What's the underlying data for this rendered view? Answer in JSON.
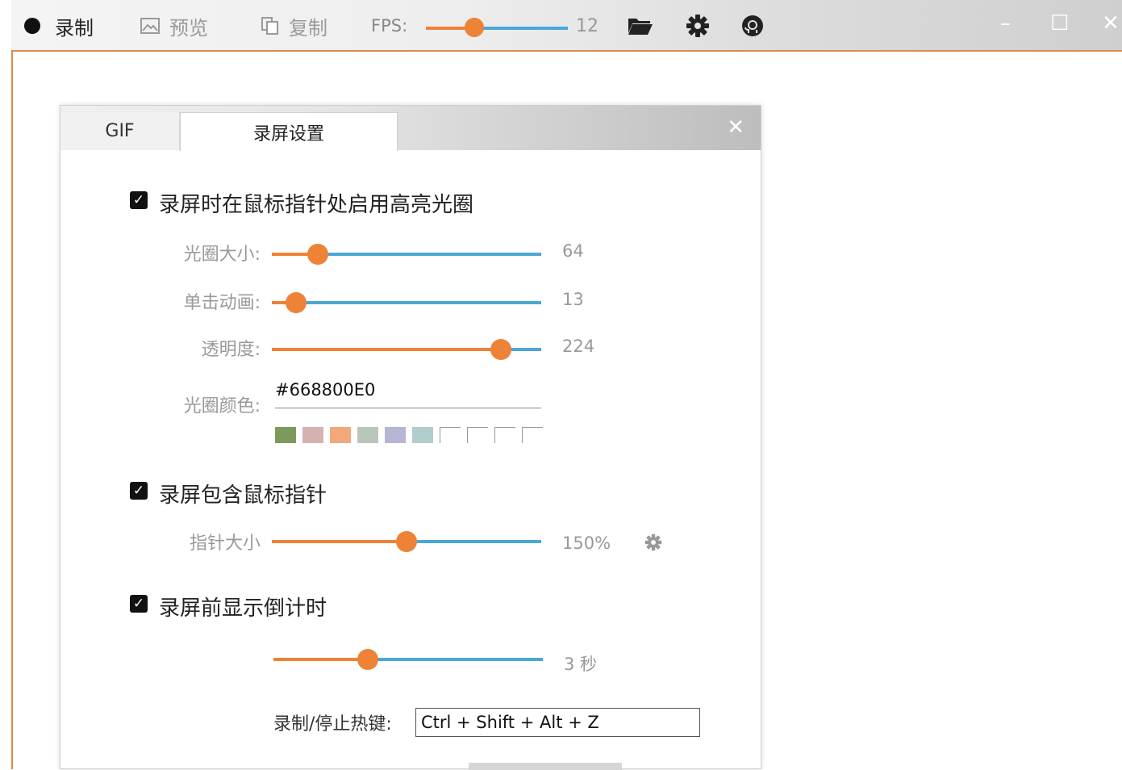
{
  "toolbar": {
    "record_label": "录制",
    "preview_label": "预览",
    "copy_label": "复制",
    "fps_label": "FPS:",
    "fps_value": "12",
    "fps_level": 0.34,
    "minimize": "–",
    "maximize": "☐",
    "close": "✕"
  },
  "dialog": {
    "tab_gif": "GIF",
    "tab_record": "录屏设置",
    "close": "✕",
    "highlight": {
      "title": "录屏时在鼠标指针处启用高亮光圈",
      "size_label": "光圈大小:",
      "size_value": "64",
      "size_level": 0.17,
      "click_label": "单击动画:",
      "click_value": "13",
      "click_level": 0.09,
      "opacity_label": "透明度:",
      "opacity_value": "224",
      "opacity_level": 0.85,
      "color_label": "光圈颜色:",
      "color_value": "#668800E0",
      "swatches": [
        "#7d9a5c",
        "#d6b1b1",
        "#f3a87b",
        "#b9c6ba",
        "#b5b5d4",
        "#b1cdcc"
      ]
    },
    "cursor": {
      "title": "录屏包含鼠标指针",
      "size_label": "指针大小",
      "size_value": "150%",
      "size_level": 0.5
    },
    "countdown": {
      "title": "录屏前显示倒计时",
      "value": "3 秒",
      "level": 0.35
    },
    "hotkey": {
      "label": "录制/停止热键:",
      "value": "Ctrl + Shift + Alt + Z"
    }
  }
}
